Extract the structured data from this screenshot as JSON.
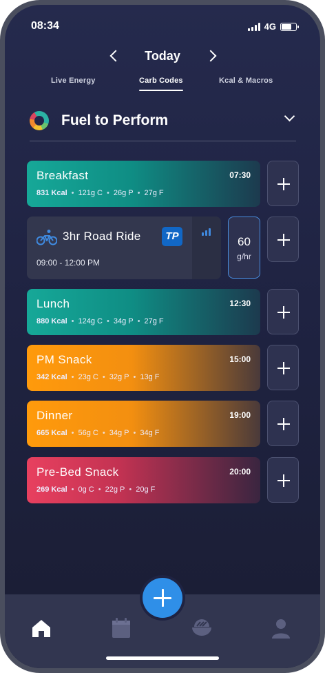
{
  "status_bar": {
    "time": "08:34",
    "network": "4G"
  },
  "date_nav": {
    "label": "Today"
  },
  "tabs": [
    {
      "label": "Live Energy",
      "active": false
    },
    {
      "label": "Carb Codes",
      "active": true
    },
    {
      "label": "Kcal & Macros",
      "active": false
    }
  ],
  "plan": {
    "title": "Fuel to Perform"
  },
  "meals": [
    {
      "name": "Breakfast",
      "time": "07:30",
      "kcal": "831 Kcal",
      "carbs": "121g C",
      "protein": "26g P",
      "fat": "27g F",
      "color": "teal"
    },
    {
      "name": "Lunch",
      "time": "12:30",
      "kcal": "880 Kcal",
      "carbs": "124g C",
      "protein": "34g P",
      "fat": "27g F",
      "color": "teal"
    },
    {
      "name": "PM Snack",
      "time": "15:00",
      "kcal": "342 Kcal",
      "carbs": "23g C",
      "protein": "32g P",
      "fat": "13g F",
      "color": "orange"
    },
    {
      "name": "Dinner",
      "time": "19:00",
      "kcal": "665 Kcal",
      "carbs": "56g C",
      "protein": "34g P",
      "fat": "34g F",
      "color": "orange"
    },
    {
      "name": "Pre-Bed Snack",
      "time": "20:00",
      "kcal": "269 Kcal",
      "carbs": "0g C",
      "protein": "22g P",
      "fat": "20g F",
      "color": "pink"
    }
  ],
  "workout": {
    "name": "3hr Road Ride",
    "time_range": "09:00 - 12:00 PM",
    "badge": "TP",
    "rate_value": "60",
    "rate_unit": "g/hr"
  },
  "separator": "•",
  "colors": {
    "accent": "#2f8fe8",
    "teal": "#16a898",
    "orange": "#ff9a0c",
    "pink": "#e8405f"
  },
  "bottom_nav": [
    "home-icon",
    "calendar-icon",
    "food-bowl-icon",
    "profile-icon"
  ]
}
